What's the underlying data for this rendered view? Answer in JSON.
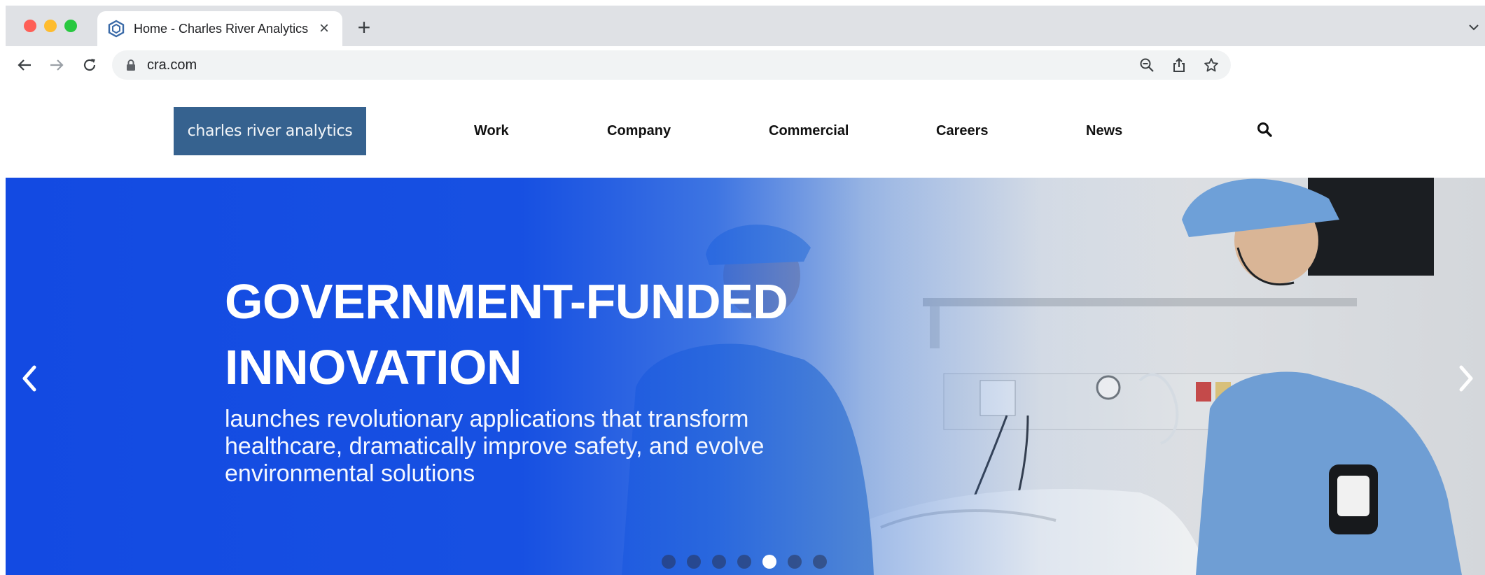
{
  "browser": {
    "tab_title": "Home - Charles River Analytics",
    "tab_close": "×",
    "new_tab": "+",
    "url": "cra.com"
  },
  "site": {
    "logo_text": "charles river analytics",
    "nav": [
      {
        "label": "Work"
      },
      {
        "label": "Company"
      },
      {
        "label": "Commercial"
      },
      {
        "label": "Careers"
      },
      {
        "label": "News"
      }
    ]
  },
  "hero": {
    "title_line1": "GOVERNMENT-FUNDED",
    "title_line2": "INNOVATION",
    "subtitle_line1": "launches revolutionary applications that transform",
    "subtitle_line2": "healthcare, dramatically improve safety, and evolve",
    "subtitle_line3": "environmental solutions",
    "slide_count": 7,
    "active_slide": 5
  },
  "colors": {
    "logo_bg": "#36628f",
    "hero_blue": "#134ae2",
    "tabbar_bg": "#dfe1e5"
  },
  "icons": {
    "favicon": "cra-hexagon-logo-icon",
    "back": "arrow-left-icon",
    "forward": "arrow-right-icon",
    "reload": "reload-icon",
    "lock": "lock-icon",
    "zoom": "zoom-out-icon",
    "share": "share-icon",
    "bookmark": "star-icon",
    "site_search": "search-icon",
    "slider_prev": "chevron-left-icon",
    "slider_next": "chevron-right-icon"
  }
}
